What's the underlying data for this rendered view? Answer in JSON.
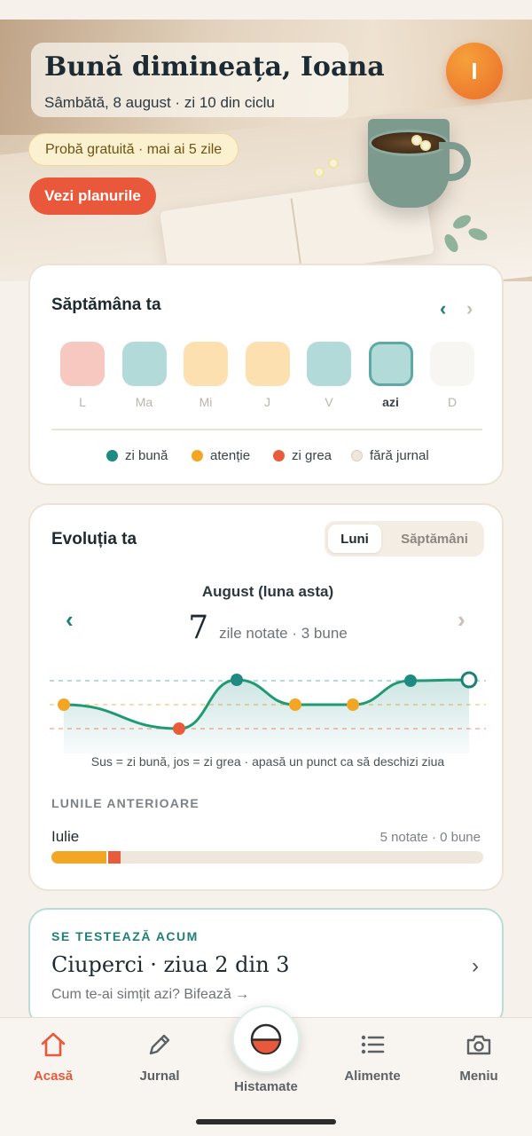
{
  "header": {
    "greeting": "Bună dimineața, Ioana",
    "subtitle": "Sâmbătă, 8 august · zi 10 din ciclu",
    "avatar_initial": "I",
    "trial_badge": "Probă gratuită · mai ai 5 zile",
    "plans_button": "Vezi planurile"
  },
  "week": {
    "title": "Săptămâna ta",
    "days": [
      {
        "label": "L",
        "status": "zi grea",
        "color": "#f6c8bf"
      },
      {
        "label": "Ma",
        "status": "zi bună",
        "color": "#b2dad8"
      },
      {
        "label": "Mi",
        "status": "atenție",
        "color": "#fde0b0"
      },
      {
        "label": "J",
        "status": "atenție",
        "color": "#fde0b0"
      },
      {
        "label": "V",
        "status": "zi bună",
        "color": "#b2dad8"
      },
      {
        "label": "azi",
        "status": "zi bună",
        "color": "#b2dad8"
      },
      {
        "label": "D",
        "status": "fără jurnal",
        "color": "#f8f6f2"
      }
    ],
    "legend": [
      {
        "label": "zi bună",
        "color": "#1f8a82"
      },
      {
        "label": "atenție",
        "color": "#f2a623"
      },
      {
        "label": "zi grea",
        "color": "#e85c3c"
      },
      {
        "label": "fără jurnal",
        "color": "#efe7db"
      }
    ]
  },
  "evolution": {
    "title": "Evoluția ta",
    "toggle_active": "Luni",
    "toggle_inactive": "Săptămâni",
    "month_title": "August (luna asta)",
    "logged_count": "7",
    "stats_text": "zile notate · 3 bune",
    "hint": "Sus = zi bună, jos = zi grea · apasă un punct ca să deschizi ziua",
    "previous_label": "LUNILE ANTERIOARE",
    "previous": {
      "name": "Iulie",
      "stats": "5 notate · 0 bune",
      "bar": [
        {
          "color": "#f2a623",
          "fraction": 0.128
        },
        {
          "color": "#e85c3c",
          "fraction": 0.033
        }
      ]
    },
    "chart_points": [
      {
        "level": "atenție",
        "color": "#f2a623"
      },
      {
        "level": "zi grea",
        "color": "#e85c3c"
      },
      {
        "level": "zi bună",
        "color": "#1f8a82"
      },
      {
        "level": "atenție",
        "color": "#f2a623"
      },
      {
        "level": "atenție",
        "color": "#f2a623"
      },
      {
        "level": "zi bună",
        "color": "#1f8a82"
      },
      {
        "level": "zi bună",
        "color": "#1f8a82",
        "today": true
      }
    ]
  },
  "test": {
    "kicker": "SE TESTEAZĂ ACUM",
    "title": "Ciuperci · ziua 2 din 3",
    "subtitle": "Cum te-ai simțit azi? Bifează →"
  },
  "tabs": {
    "home": "Acasă",
    "journal": "Jurnal",
    "center": "Histamate",
    "foods": "Alimente",
    "menu": "Meniu"
  },
  "colors": {
    "accent": "#e9583b",
    "teal": "#1f8a82",
    "amber": "#f2a623",
    "red": "#e85c3c"
  }
}
